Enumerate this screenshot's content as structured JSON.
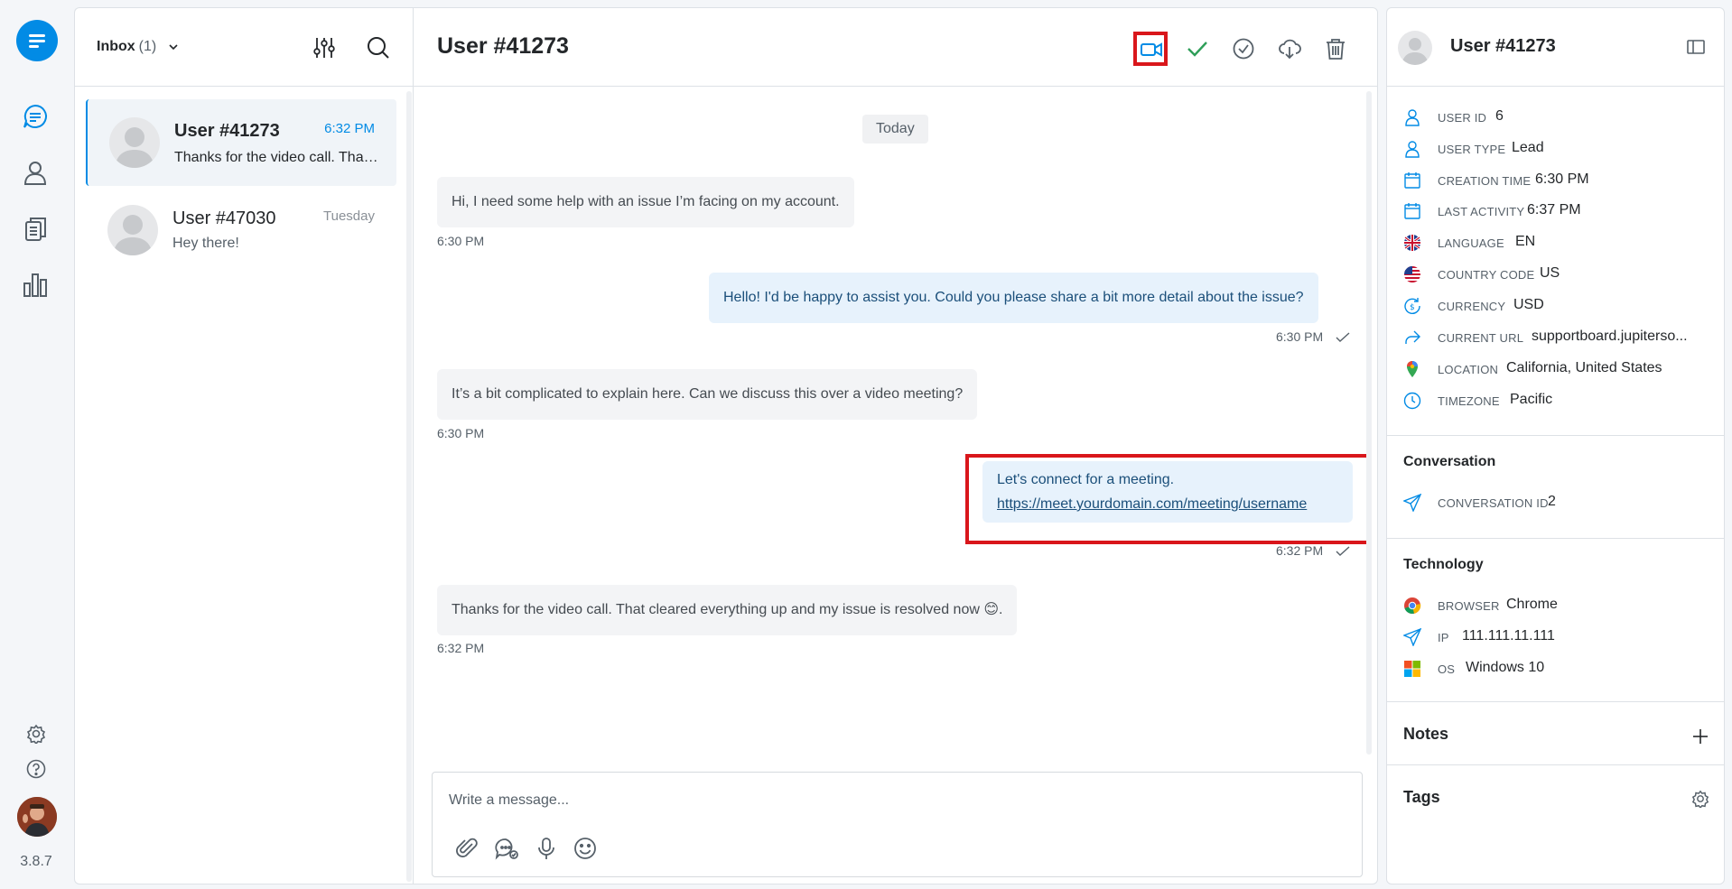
{
  "app": {
    "version": "3.8.7",
    "colors": {
      "accent": "#028be5",
      "highlight": "#d9161b",
      "outgoing_bubble": "#e7f2fc",
      "incoming_bubble": "#f3f4f6"
    }
  },
  "rail": {
    "items": [
      {
        "name": "conversations",
        "icon": "chat-bubble-icon"
      },
      {
        "name": "users",
        "icon": "user-icon"
      },
      {
        "name": "articles",
        "icon": "documents-icon"
      },
      {
        "name": "reports",
        "icon": "bar-chart-icon"
      }
    ],
    "bottom": [
      {
        "name": "settings",
        "icon": "gear-icon"
      },
      {
        "name": "help",
        "icon": "question-icon"
      }
    ]
  },
  "list": {
    "inbox_label": "Inbox",
    "inbox_count": "(1)",
    "conversations": [
      {
        "name": "User #41273",
        "time": "6:32 PM",
        "preview": "Thanks for the video call. That cleared everything up and my issue is resolved now 😊.",
        "active": true
      },
      {
        "name": "User #47030",
        "time": "Tuesday",
        "preview": "Hey there!",
        "active": false
      }
    ]
  },
  "chat": {
    "title": "User #41273",
    "date_divider": "Today",
    "messages": [
      {
        "direction": "in",
        "text": "Hi, I need some help with an issue I’m facing on my account.",
        "time": "6:30 PM"
      },
      {
        "direction": "out",
        "text": "Hello! I'd be happy to assist you. Could you please share a bit more detail about the issue?",
        "time": "6:30 PM"
      },
      {
        "direction": "in",
        "text": "It’s a bit complicated to explain here. Can we discuss this over a video meeting?",
        "time": "6:30 PM"
      },
      {
        "direction": "out",
        "text": "Let's connect for a meeting.",
        "link": "https://meet.yourdomain.com/meeting/username",
        "time": "6:32 PM"
      },
      {
        "direction": "in",
        "text": "Thanks for the video call. That cleared everything up and my issue is resolved now 😊.",
        "time": "6:32 PM"
      }
    ],
    "composer_placeholder": "Write a message..."
  },
  "info": {
    "name": "User #41273",
    "fields": [
      {
        "label": "User ID",
        "value": "6",
        "icon": "user-outline-icon"
      },
      {
        "label": "User Type",
        "value": "Lead",
        "icon": "user-outline-icon"
      },
      {
        "label": "Creation Time",
        "value": "6:30 PM",
        "icon": "calendar-icon"
      },
      {
        "label": "Last Activity",
        "value": "6:37 PM",
        "icon": "calendar-icon"
      },
      {
        "label": "Language",
        "value": "EN",
        "icon": "uk-flag-icon"
      },
      {
        "label": "Country Code",
        "value": "US",
        "icon": "us-flag-icon"
      },
      {
        "label": "Currency",
        "value": "USD",
        "icon": "currency-icon"
      },
      {
        "label": "Current URL",
        "value": "supportboard.jupiterso...",
        "icon": "share-arrow-icon"
      },
      {
        "label": "Location",
        "value": "California, United States",
        "icon": "map-pin-icon"
      },
      {
        "label": "Timezone",
        "value": "Pacific",
        "icon": "clock-icon"
      }
    ],
    "conversation_section": "Conversation",
    "conversation_id_label": "Conversation ID",
    "conversation_id": "2",
    "technology_section": "Technology",
    "technology": [
      {
        "label": "Browser",
        "value": "Chrome",
        "icon": "chrome-icon"
      },
      {
        "label": "IP",
        "value": "111.111.11.111",
        "icon": "send-icon"
      },
      {
        "label": "OS",
        "value": "Windows 10",
        "icon": "windows-icon"
      }
    ],
    "notes_title": "Notes",
    "tags_title": "Tags"
  }
}
